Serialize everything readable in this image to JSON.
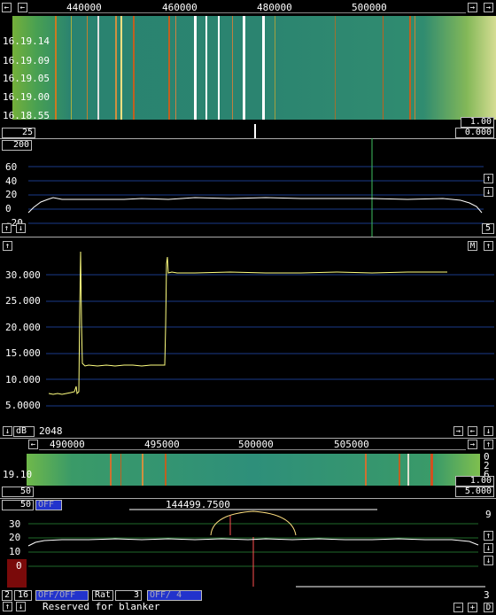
{
  "waterfall_top": {
    "freq_ticks": [
      "440000",
      "460000",
      "480000",
      "500000"
    ],
    "time_labels": [
      "16.19.14",
      "16.19.09",
      "16.19.05",
      "16.19.00",
      "16.18.55"
    ],
    "avg": "25",
    "gain": "1.00",
    "offset": "0.000"
  },
  "spectrum": {
    "top_value": "200",
    "y_ticks": [
      "60",
      "40",
      "20",
      "0",
      "-20"
    ],
    "right_value": "5"
  },
  "time_plot": {
    "y_ticks": [
      "30.000",
      "25.000",
      "20.000",
      "15.000",
      "10.000",
      "5.0000"
    ],
    "mode_button": "M",
    "db_label": "dB",
    "fft_size": "2048"
  },
  "waterfall_bottom": {
    "freq_ticks": [
      "490000",
      "495000",
      "500000",
      "505000"
    ],
    "time_label": "19.10",
    "left_value": "50",
    "gain": "1.00",
    "offset": "5.000",
    "right_nums": [
      "0",
      "2",
      "6"
    ]
  },
  "baseband": {
    "avg_value": "50",
    "off_label": "OFF",
    "freq_readout": "144499.7500",
    "y_ticks": [
      "30",
      "20",
      "10",
      "0"
    ],
    "right_top": "9",
    "right_bottom": "3"
  },
  "bottom_bar": {
    "num_a": "2",
    "num_b": "16",
    "mode_a": "OFF/OFF",
    "rat_label": "Rat",
    "rat_value": "3",
    "mode_b": "OFF/ 4",
    "status_text": "Reserved for blanker",
    "minus": "−",
    "plus": "+",
    "d_label": "D"
  },
  "colors": {
    "accent_blue": "#2233cc",
    "trace_yellow": "#ffff80",
    "grid_blue": "#1a3a8a"
  }
}
